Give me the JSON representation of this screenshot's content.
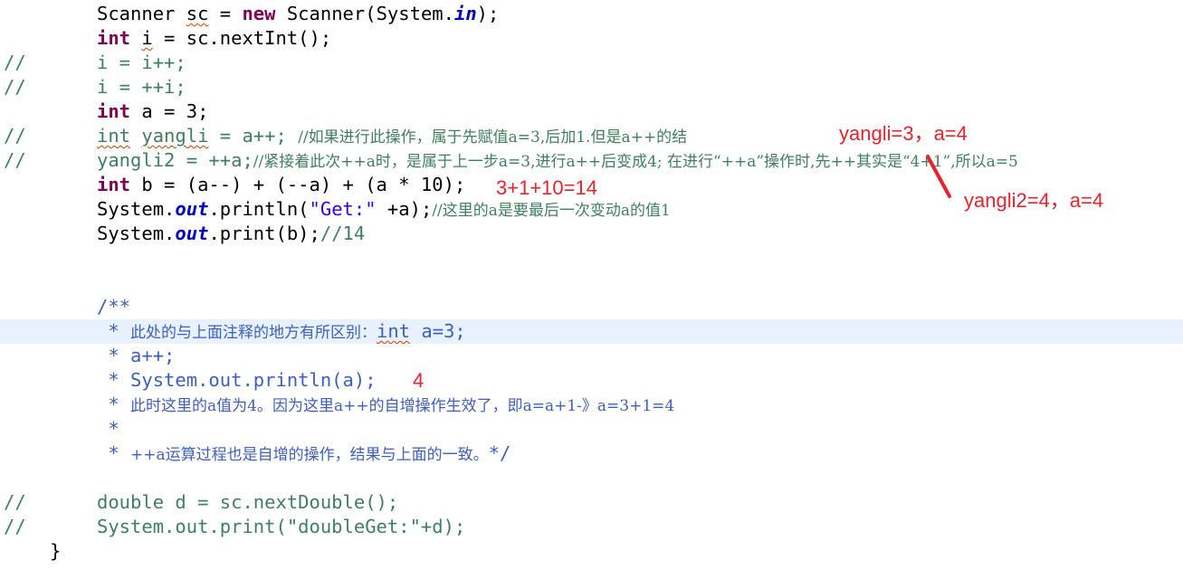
{
  "code": {
    "l1": {
      "p1": "Scanner ",
      "sc": "sc",
      "p2": " = ",
      "new": "new",
      "p3": " Scanner(System.",
      "in": "in",
      "p4": ");"
    },
    "l2": {
      "kw": "int",
      "p1": " ",
      "i": "i",
      "p2": " = sc.nextInt();"
    },
    "l3": {
      "prefix": "//",
      "text": "i = i++;"
    },
    "l4": {
      "prefix": "//",
      "text": "i = ++i;"
    },
    "l5": {
      "kw": "int",
      "text": " a = 3;"
    },
    "l6": {
      "prefix": "//",
      "kw": "int",
      "sp": " ",
      "var": "yangli",
      "code": " = a++; ",
      "comment": "//如果进行此操作，属于先赋值a=3,后加1.但是a++的结"
    },
    "l7": {
      "prefix": "//",
      "code": "yangli2 = ++a;",
      "comment": "//紧接着此次++a时，是属于上一步a=3,进行a++后变成4; 在进行“++a”操作时,先++其实是“4+1”,所以a=5"
    },
    "l8": {
      "kw": "int",
      "text": " b = (a--) + (--a) + (a * 10);"
    },
    "l9": {
      "p1": "System.",
      "out": "out",
      "p2": ".println(",
      "str": "\"Get:\"",
      "p3": " +a);",
      "comment": "//这里的a是要最后一次变动a的值1"
    },
    "l10": {
      "p1": "System.",
      "out": "out",
      "p2": ".print(b);",
      "comment": "//14"
    },
    "l11": {
      "text": "/**"
    },
    "l12": {
      "p1": " * ",
      "cn": "此处的与上面注释的地方有所区别：",
      "int": "int",
      "p2": " a=3;"
    },
    "l13": {
      "text": " * a++;"
    },
    "l14": {
      "text": " * System.out.println(a);"
    },
    "l15": {
      "p1": " * ",
      "text": "此时这里的a值为4。因为这里a++的自增操作生效了，即a=a+1-》a=3+1=4"
    },
    "l16": {
      "text": " *"
    },
    "l17": {
      "p1": " * ",
      "cn": "++a运算过程也是自增的操作，结果与上面的一致。",
      "end": "*/"
    },
    "l18": {
      "prefix": "//",
      "text": "double d = sc.nextDouble();"
    },
    "l19": {
      "prefix": "//",
      "text": "System.out.print(\"doubleGet:\"+d);"
    },
    "l20": {
      "text": "}"
    }
  },
  "annotations": {
    "a1": "yangli=3，a=4",
    "a2": "yangli2=4，a=4",
    "a3": "3+1+10=14",
    "a4": "4"
  },
  "colors": {
    "keyword": "#7f0055",
    "string": "#2a00ff",
    "comment": "#3f7f5f",
    "javadoc": "#3f5fbf",
    "annotation": "#e8232d",
    "current_line": "#e8f2fe"
  }
}
